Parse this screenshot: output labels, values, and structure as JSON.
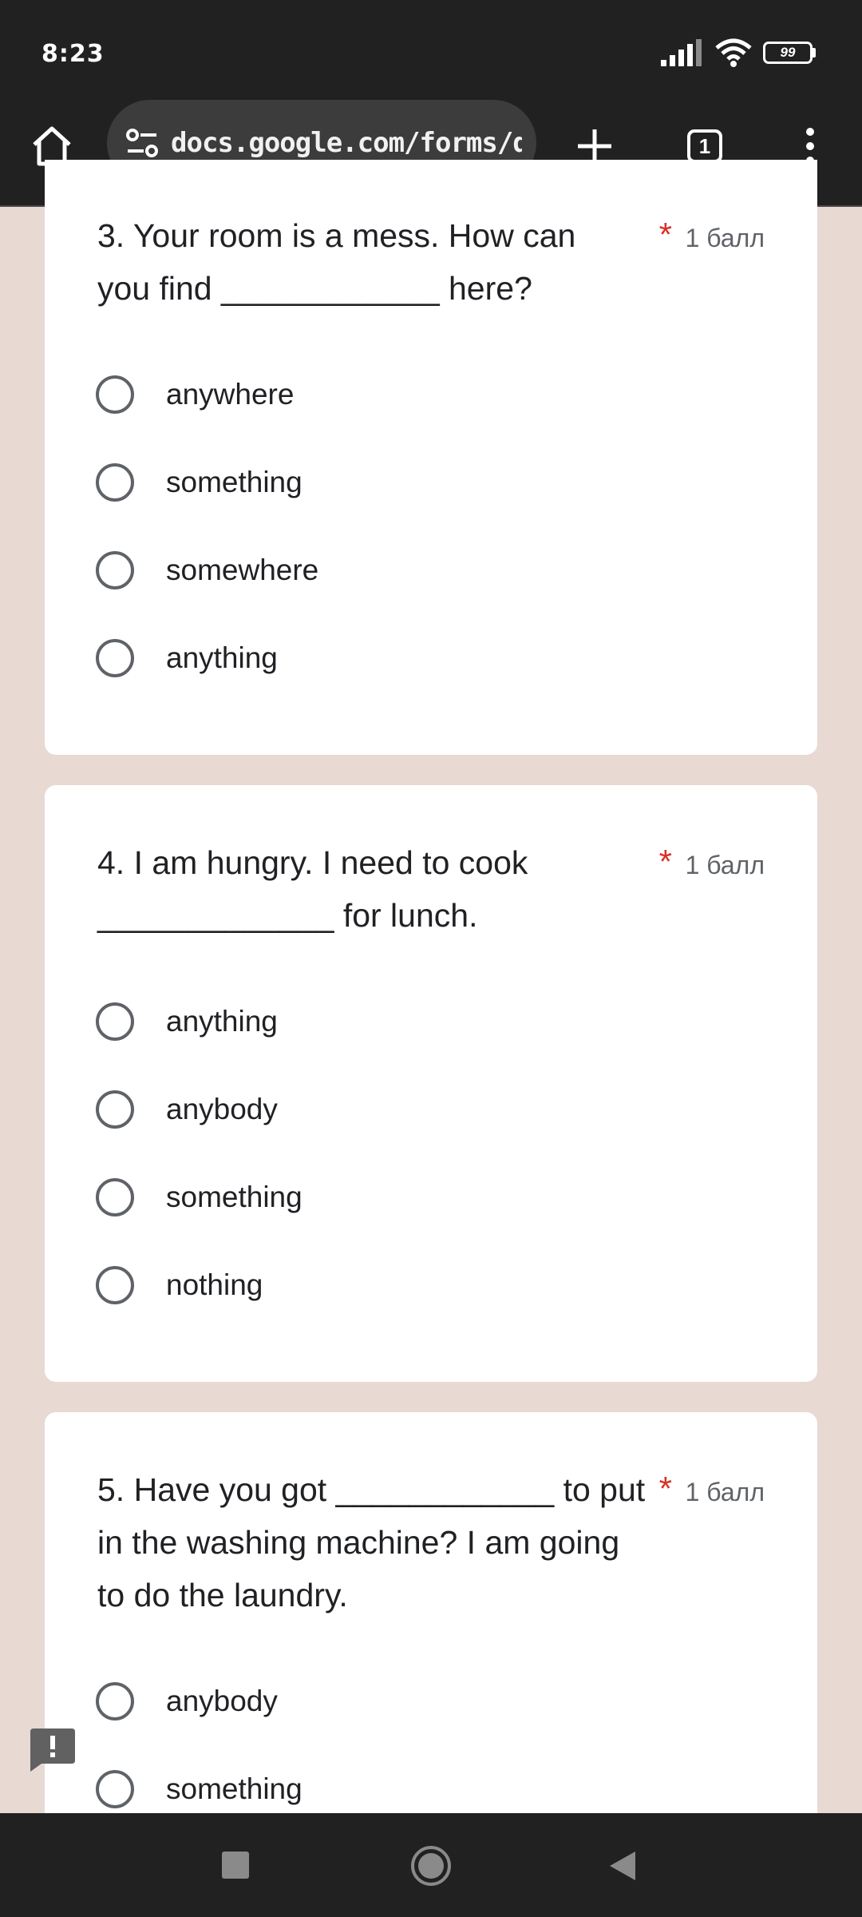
{
  "status": {
    "time": "8:23",
    "battery": "99"
  },
  "browser": {
    "url": "docs.google.com/forms/d/",
    "tab_count": "1"
  },
  "questions": [
    {
      "text": "3. Your room is a mess. How can you find ____________ here?",
      "required_mark": "*",
      "points": "1 балл",
      "options": [
        "anywhere",
        "something",
        "somewhere",
        "anything"
      ]
    },
    {
      "text": "4. I am hungry. I need to cook _____________ for lunch.",
      "required_mark": "*",
      "points": "1 балл",
      "options": [
        "anything",
        "anybody",
        "something",
        "nothing"
      ]
    },
    {
      "text": "5. Have you got ____________ to put in the washing machine? I am going to do the laundry.",
      "required_mark": "*",
      "points": "1 балл",
      "options": [
        "anybody",
        "something"
      ]
    }
  ],
  "colors": {
    "accent_required": "#d93025",
    "page_bg": "#e8d9d3"
  },
  "icons": [
    "home-icon",
    "site-settings-icon",
    "new-tab-icon",
    "tabs-icon",
    "more-menu-icon",
    "report-icon",
    "recents-icon",
    "home-nav-icon",
    "back-icon"
  ]
}
